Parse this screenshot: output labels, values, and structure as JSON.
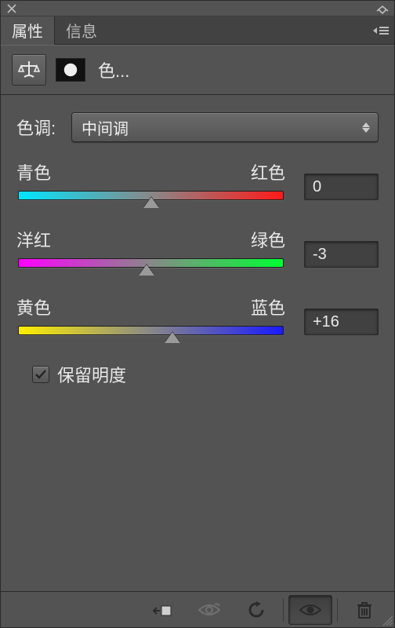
{
  "tabs": {
    "properties": "属性",
    "info": "信息"
  },
  "adjustment": {
    "title": "色..."
  },
  "tone": {
    "label": "色调:",
    "selected": "中间调"
  },
  "sliders": {
    "cyan_red": {
      "left": "青色",
      "right": "红色",
      "value": "0",
      "pos": 50
    },
    "magenta_green": {
      "left": "洋红",
      "right": "绿色",
      "value": "-3",
      "pos": 48.5
    },
    "yellow_blue": {
      "left": "黄色",
      "right": "蓝色",
      "value": "+16",
      "pos": 58
    }
  },
  "preserve_luminosity": {
    "label": "保留明度",
    "checked": true
  }
}
